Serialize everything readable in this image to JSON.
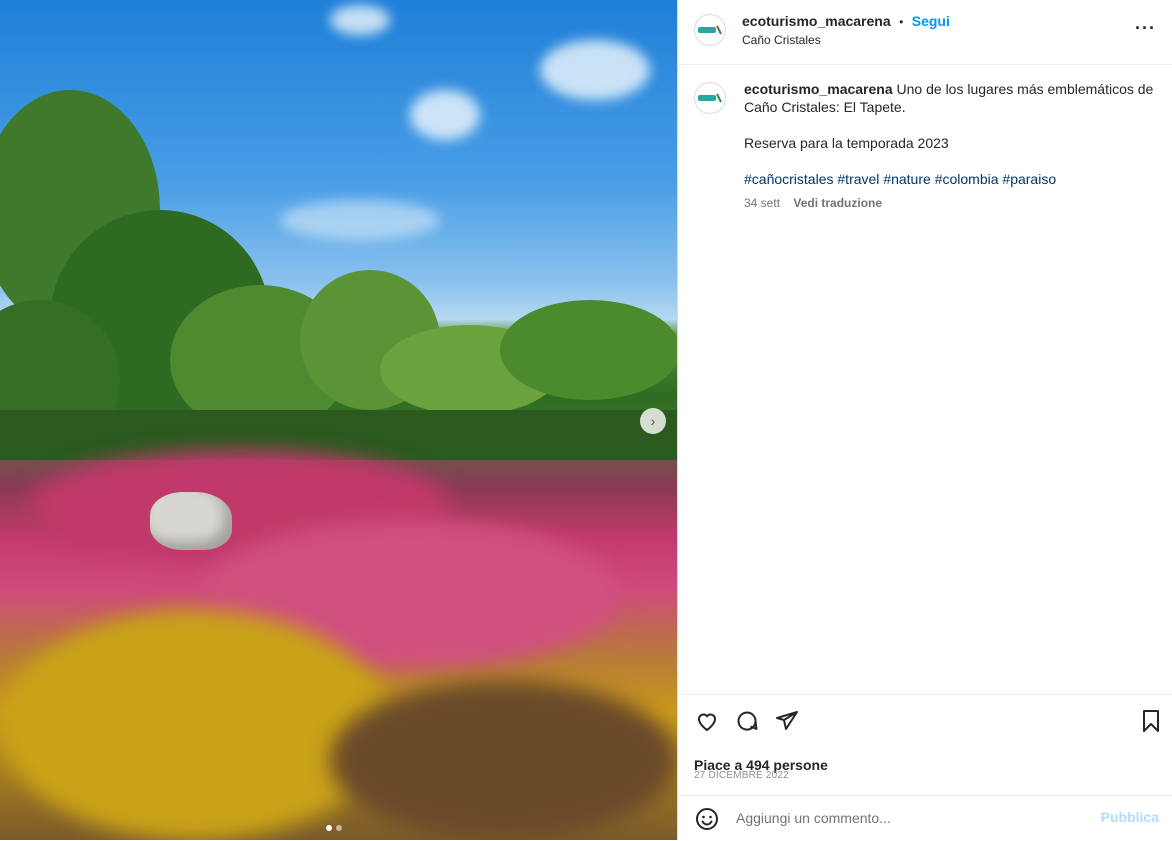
{
  "post": {
    "image_alt": "",
    "carousel": {
      "current": 1,
      "total": 2
    }
  },
  "header": {
    "username": "ecoturismo_macarena",
    "separator": "•",
    "follow_label": "Segui",
    "location": "Caño Cristales",
    "more_icon": "more-horizontal-icon"
  },
  "caption": {
    "username": "ecoturismo_macarena",
    "text_line1": "Uno de los lugares más emblemáticos de Caño Cristales: El Tapete.",
    "text_line2": "Reserva para la temporada 2023",
    "hashtags": [
      "#cañocristales",
      "#travel",
      "#nature",
      "#colombia",
      "#paraiso"
    ],
    "time": "34 sett",
    "translate_label": "Vedi traduzione"
  },
  "actions": {
    "like_icon": "heart-icon",
    "comment_icon": "comment-icon",
    "share_icon": "send-icon",
    "save_icon": "bookmark-icon",
    "likes_text": "Piace a 494 persone",
    "date_text": "27 DICEMBRE 2022"
  },
  "comment": {
    "emoji_icon": "emoji-icon",
    "placeholder": "Aggiungi un commento...",
    "publish_label": "Pubblica"
  }
}
